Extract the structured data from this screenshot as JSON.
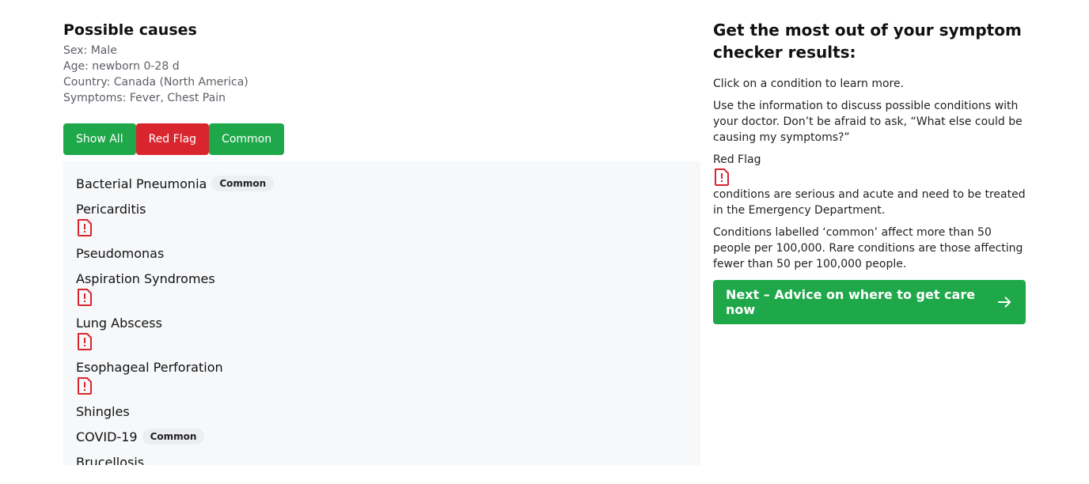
{
  "left": {
    "title": "Possible causes",
    "meta": {
      "sex": "Sex: Male",
      "age": "Age: newborn 0-28 d",
      "country": "Country: Canada (North America)",
      "symptoms": "Symptoms: Fever, Chest Pain"
    },
    "filters": {
      "show_all": "Show All",
      "red_flag": "Red Flag",
      "common": "Common"
    },
    "conditions": [
      {
        "name": "Bacterial Pneumonia",
        "badge": "Common"
      },
      {
        "name": "Pericarditis"
      },
      {
        "name": "Pseudomonas"
      },
      {
        "name": "Aspiration Syndromes"
      },
      {
        "name": "Lung Abscess"
      },
      {
        "name": "Esophageal Perforation"
      },
      {
        "name": "Shingles"
      },
      {
        "name": "COVID-19",
        "badge": "Common"
      },
      {
        "name": "Brucellosis"
      }
    ]
  },
  "right": {
    "title": "Get the most out of your symptom checker results:",
    "para1": "Click on a condition to learn more.",
    "para2": "Use the information to discuss possible conditions with your doctor. Don’t be afraid to ask, “What else could be causing my symptoms?”",
    "red_flag_label": "Red Flag",
    "para3": "conditions are serious and acute and need to be treated in the Emergency Department.",
    "para4": "Conditions labelled ‘common’ affect more than 50 people per 100,000. Rare conditions are those affecting fewer than 50 per 100,000 people.",
    "next_button": "Next – Advice on where to get care now"
  },
  "colors": {
    "green": "#1fa84a",
    "red": "#d9262e",
    "panel_bg": "#f7f8fa"
  },
  "icons": [
    "red-flag-icon",
    "arrow-right-icon"
  ]
}
